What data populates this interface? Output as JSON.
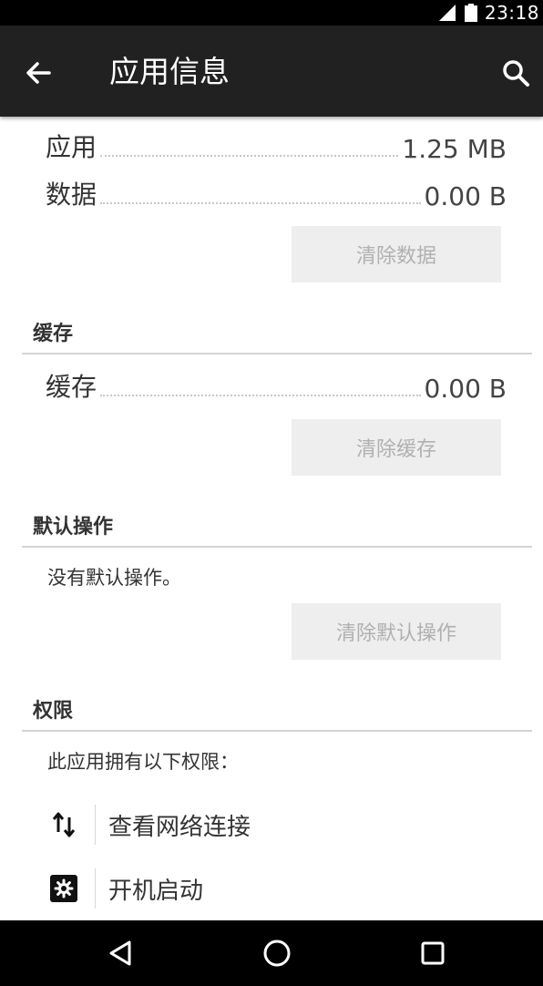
{
  "status_bar": {
    "time": "23:18",
    "signal_icon": "signal-icon",
    "battery_icon": "battery-icon"
  },
  "app_bar": {
    "title": "应用信息",
    "back_icon": "arrow-back-icon",
    "search_icon": "search-icon"
  },
  "storage": {
    "rows": [
      {
        "label": "应用",
        "value": "1.25 MB"
      },
      {
        "label": "数据",
        "value": "0.00 B"
      }
    ],
    "clear_data_label": "清除数据"
  },
  "cache": {
    "header": "缓存",
    "row": {
      "label": "缓存",
      "value": "0.00 B"
    },
    "clear_cache_label": "清除缓存"
  },
  "defaults": {
    "header": "默认操作",
    "text": "没有默认操作。",
    "clear_defaults_label": "清除默认操作"
  },
  "permissions": {
    "header": "权限",
    "intro": "此应用拥有以下权限：",
    "items": [
      {
        "icon": "network-arrows-icon",
        "label": "查看网络连接"
      },
      {
        "icon": "gear-icon",
        "label": "开机启动"
      }
    ]
  },
  "nav_bar": {
    "back_icon": "nav-back-icon",
    "home_icon": "nav-home-icon",
    "recents_icon": "nav-recents-icon"
  }
}
